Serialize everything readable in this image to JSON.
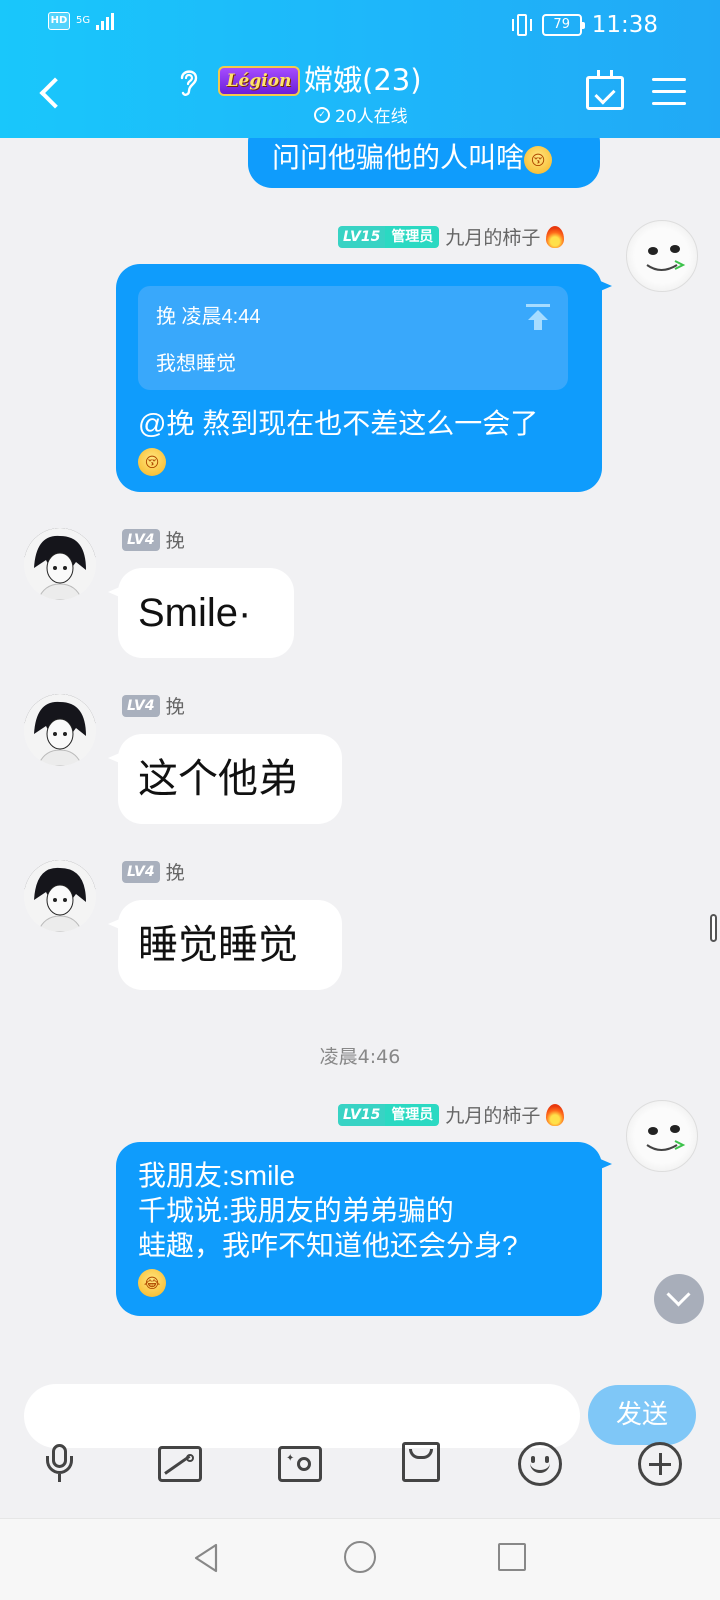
{
  "status_bar": {
    "hd": "HD",
    "network": "5G",
    "battery": "79",
    "time": "11:38"
  },
  "header": {
    "badge": "Légion",
    "title": "嫦娥(23)",
    "online": "20人在线"
  },
  "messages": [
    {
      "text": "问问他骗他的人叫啥",
      "emoji": "😚"
    },
    {
      "level": "LV15",
      "role": "管理员",
      "sender": "九月的柿子",
      "quote_header": "挽 凌晨4:44",
      "quote_text": "我想睡觉",
      "text": "@挽 熬到现在也不差这么一会了",
      "emoji": "😚"
    },
    {
      "level": "LV4",
      "sender": "挽",
      "text": "Smile·"
    },
    {
      "level": "LV4",
      "sender": "挽",
      "text": "这个他弟"
    },
    {
      "level": "LV4",
      "sender": "挽",
      "text": "睡觉睡觉"
    },
    {
      "level": "LV15",
      "role": "管理员",
      "sender": "九月的柿子",
      "line1": "我朋友:smile",
      "line2": "千城说:我朋友的弟弟骗的",
      "line3": "蛙趣，我咋不知道他还会分身?",
      "emoji": "😂"
    }
  ],
  "timestamp": "凌晨4:46",
  "input": {
    "placeholder": "",
    "send_label": "发送"
  },
  "toolbar_icons": [
    "microphone-icon",
    "image-icon",
    "camera-icon",
    "red-envelope-icon",
    "emoji-icon",
    "plus-icon"
  ],
  "colors": {
    "header": "#1eb6fa",
    "my_bubble": "#0f9cfc",
    "send_button": "#7fc7f7"
  }
}
